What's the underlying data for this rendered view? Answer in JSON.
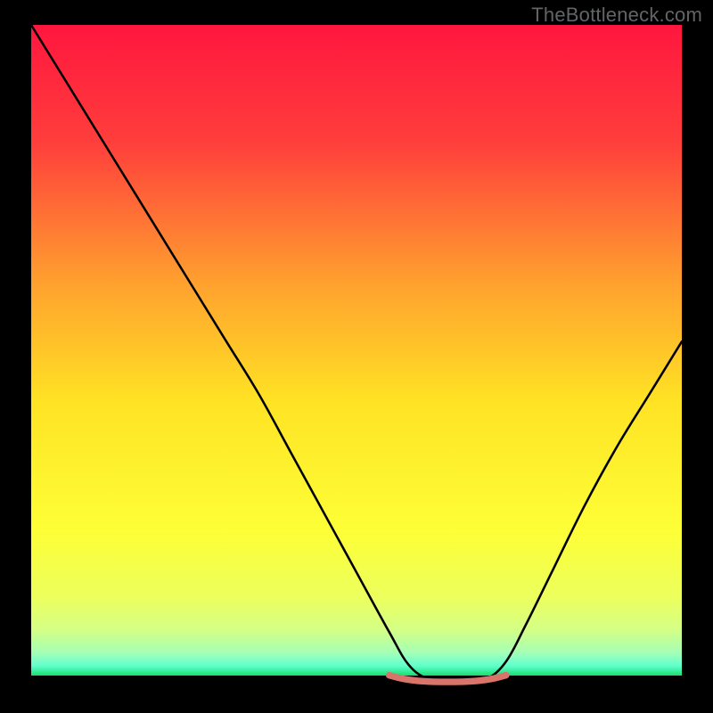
{
  "watermark": "TheBottleneck.com",
  "chart_data": {
    "type": "line",
    "title": "",
    "xlabel": "",
    "ylabel": "",
    "xlim": [
      0,
      100
    ],
    "ylim": [
      0,
      100
    ],
    "grid": false,
    "legend": false,
    "annotations": [],
    "gradient_stops": [
      {
        "offset": 0.0,
        "color": "#ff163e"
      },
      {
        "offset": 0.18,
        "color": "#ff3e3c"
      },
      {
        "offset": 0.4,
        "color": "#ffa22e"
      },
      {
        "offset": 0.58,
        "color": "#ffe324"
      },
      {
        "offset": 0.78,
        "color": "#fdff37"
      },
      {
        "offset": 0.88,
        "color": "#ecff5d"
      },
      {
        "offset": 0.93,
        "color": "#d4ff86"
      },
      {
        "offset": 0.965,
        "color": "#a4ffb6"
      },
      {
        "offset": 0.985,
        "color": "#60ffce"
      },
      {
        "offset": 1.0,
        "color": "#16e06e"
      }
    ],
    "series": [
      {
        "name": "bottleneck-curve",
        "color": "#000000",
        "x": [
          0,
          5,
          10,
          15,
          20,
          25,
          30,
          35,
          40,
          45,
          50,
          55,
          58,
          61,
          64,
          67,
          70,
          73,
          76,
          80,
          85,
          90,
          95,
          100
        ],
        "y": [
          100,
          92,
          84,
          76,
          68,
          60,
          52,
          44,
          35,
          26,
          17,
          8,
          3,
          0.8,
          0.3,
          0.3,
          0.8,
          3.5,
          9,
          17,
          27,
          36,
          44,
          52
        ]
      },
      {
        "name": "optimal-band",
        "color": "#d9746a",
        "x": [
          55,
          57,
          59,
          61,
          63,
          65,
          67,
          69,
          71,
          73
        ],
        "y": [
          1.4,
          0.9,
          0.6,
          0.45,
          0.4,
          0.4,
          0.45,
          0.6,
          0.9,
          1.4
        ]
      }
    ]
  }
}
